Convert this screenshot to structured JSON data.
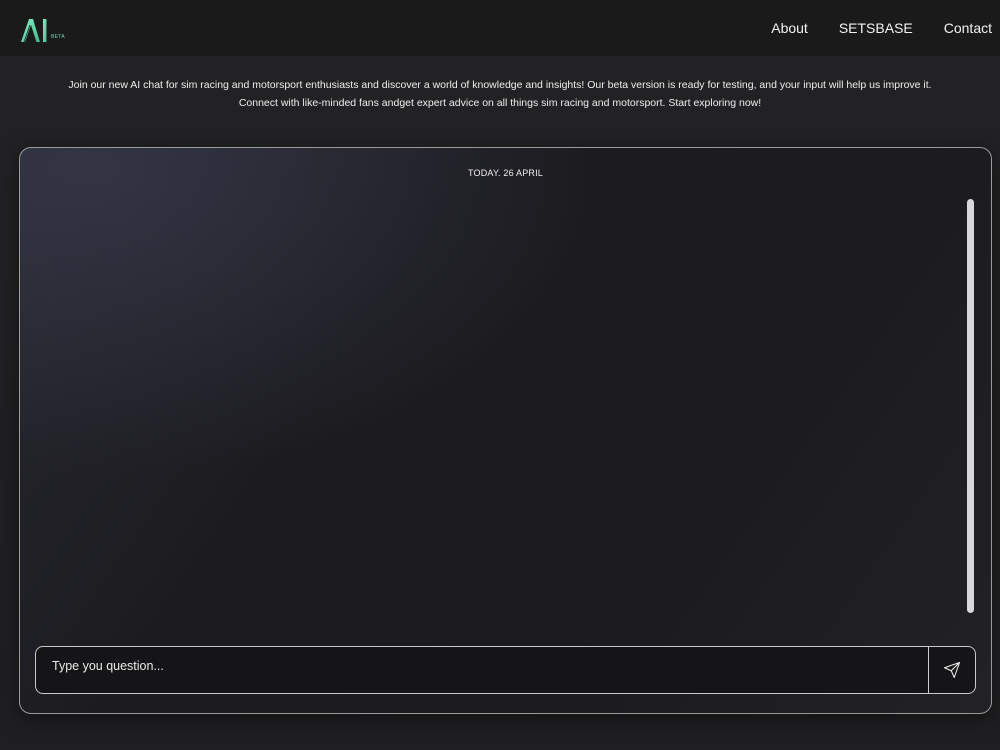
{
  "header": {
    "logo_text": "AI",
    "logo_badge": "BETA",
    "nav": [
      {
        "label": "About"
      },
      {
        "label": "SETSBASE"
      },
      {
        "label": "Contact"
      }
    ],
    "accent_color": "#5ed6a8"
  },
  "intro": {
    "line1": "Join our new AI chat for sim racing and motorsport enthusiasts and discover a world of knowledge and insights! Our beta version is ready for testing, and your input will help us improve it.",
    "line2": "Connect with like-minded fans andget expert advice on all things sim racing and motorsport. Start exploring now!"
  },
  "chat": {
    "date_label": "TODAY. 26 APRIL",
    "input": {
      "value": "",
      "placeholder": "Type you question..."
    },
    "send_icon": "send-icon"
  }
}
